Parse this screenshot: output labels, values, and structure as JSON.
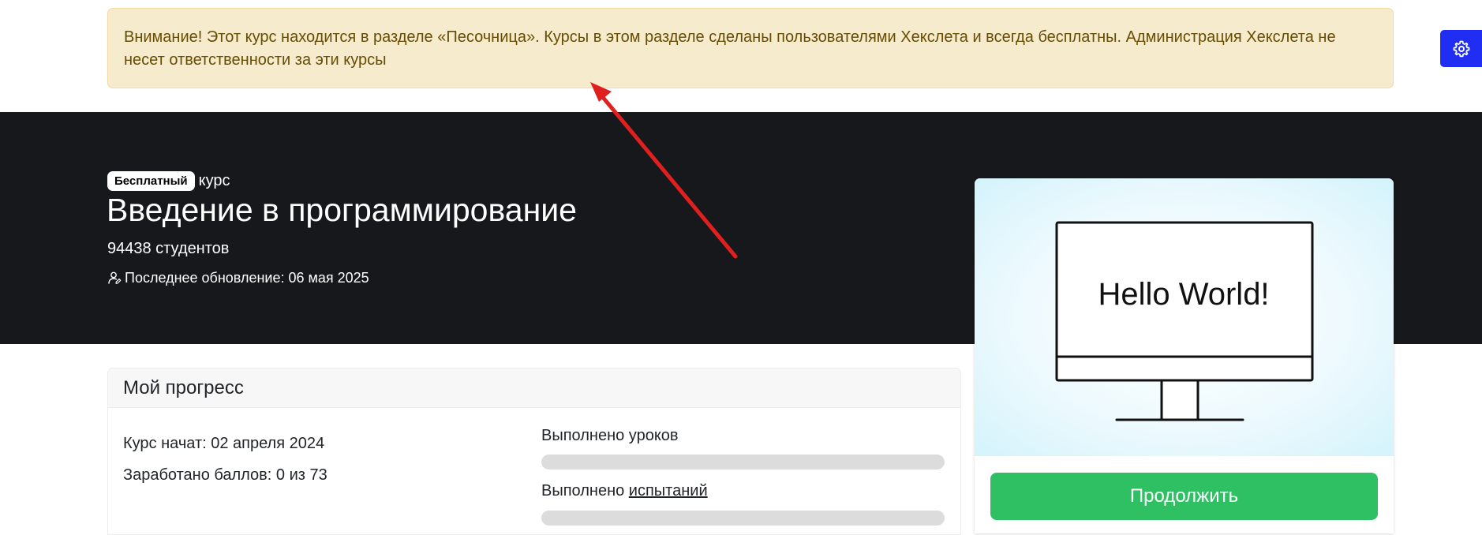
{
  "alert": {
    "text": "Внимание! Этот курс находится в разделе «Песочница». Курсы в этом разделе сделаны пользователями Хекслета и всегда бесплатны. Администрация Хекслета не несет ответственности за эти курсы"
  },
  "settings": {
    "icon": "gear-icon"
  },
  "course": {
    "badge": "Бесплатный",
    "type_label": "курс",
    "title": "Введение в программирование",
    "students": "94438 студентов",
    "updated_label": "Последнее обновление: 06 мая 2025"
  },
  "card": {
    "image_text": "Hello World!",
    "continue_label": "Продолжить"
  },
  "progress": {
    "header": "Мой прогресс",
    "started": "Курс начат: 02 апреля 2024",
    "points": "Заработано баллов: 0 из 73",
    "lessons_label": "Выполнено уроков",
    "lessons_progress": 0,
    "challenges_label_prefix": "Выполнено",
    "challenges_link": "испытаний",
    "challenges_progress": 0
  },
  "colors": {
    "accent_green": "#2fc064",
    "settings_blue": "#1f2ef2",
    "hero_dark": "#17181b",
    "alert_bg": "#f6ebcd",
    "annotation_red": "#e0201f"
  }
}
